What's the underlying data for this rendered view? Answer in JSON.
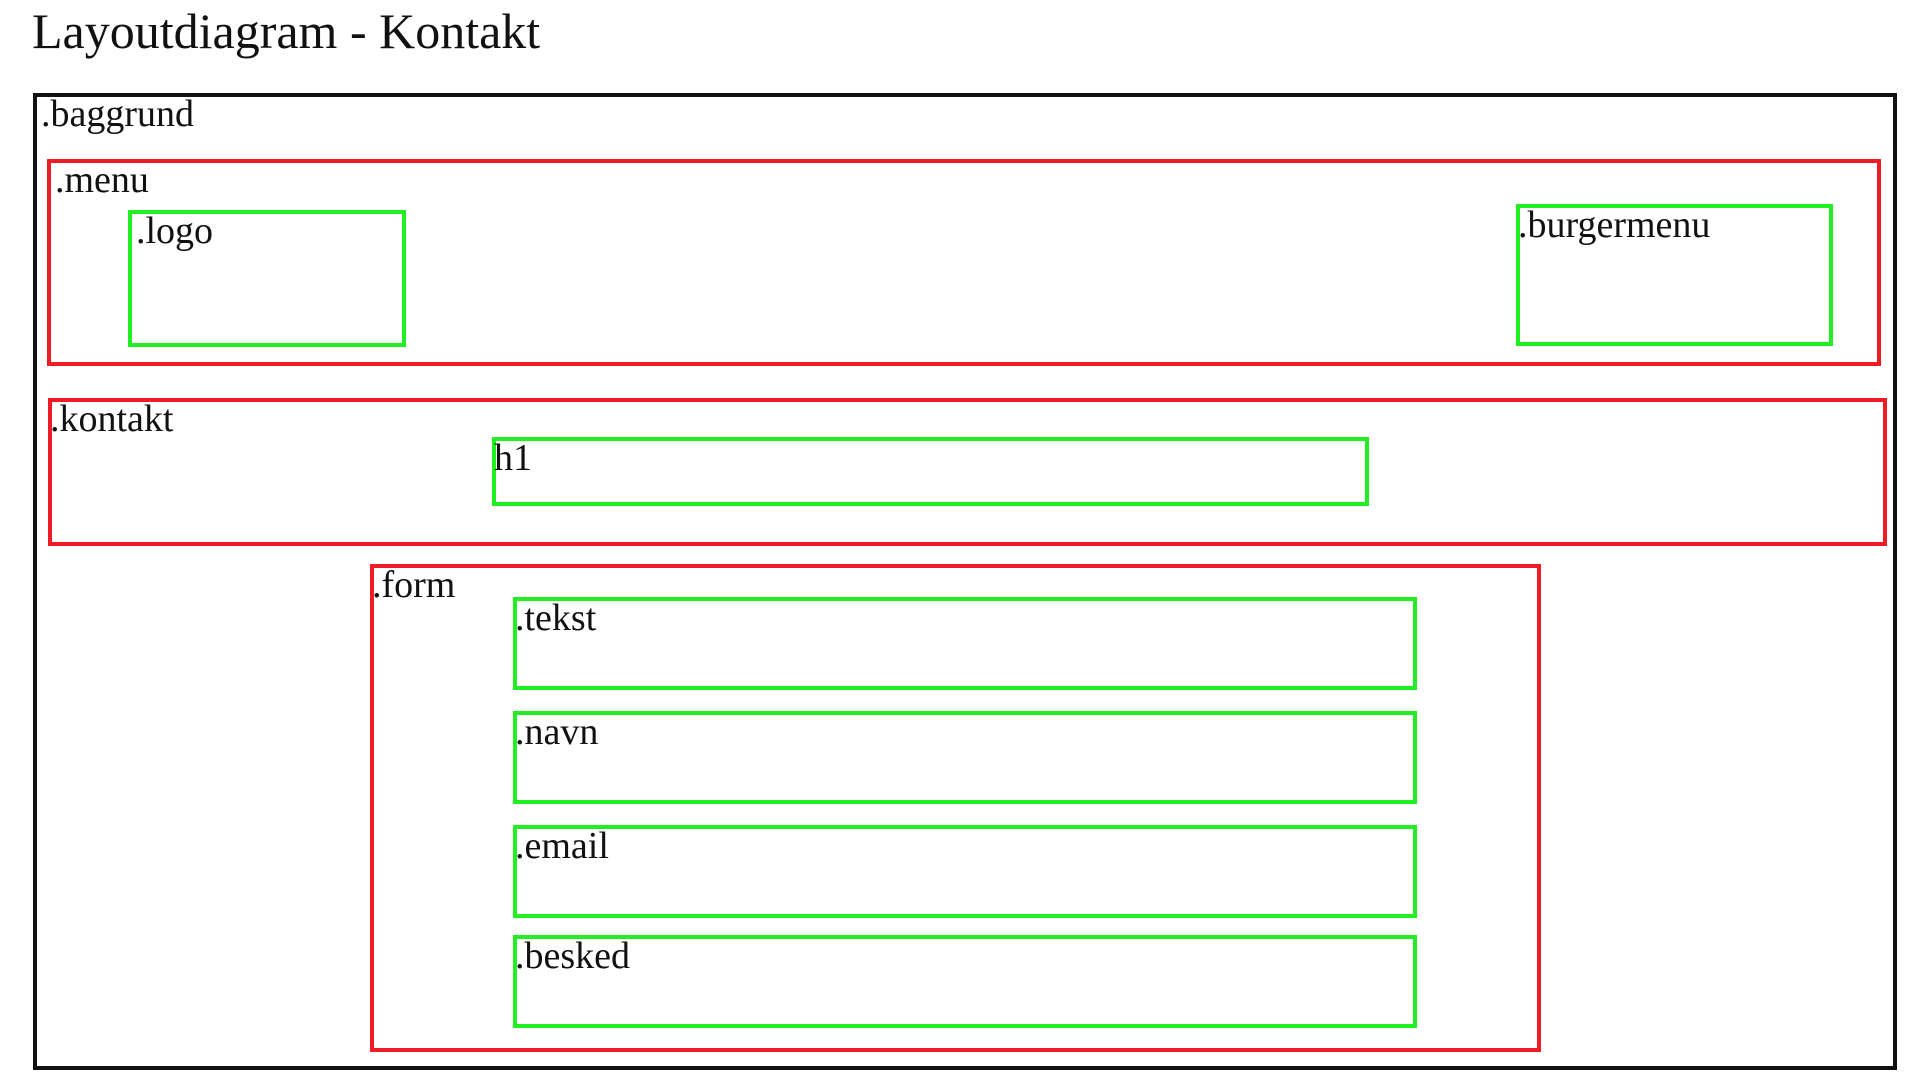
{
  "title": "Layoutdiagram - Kontakt",
  "colors": {
    "outer": "#111111",
    "section": "#ee1c24",
    "element": "#22ee22"
  },
  "boxes": {
    "baggrund": ".baggrund",
    "menu": ".menu",
    "logo": ".logo",
    "burgermenu": ".burgermenu",
    "kontakt": ".kontakt",
    "h1": "h1",
    "form": ".form",
    "tekst": ".tekst",
    "navn": ".navn",
    "email": ".email",
    "besked": ".besked"
  }
}
